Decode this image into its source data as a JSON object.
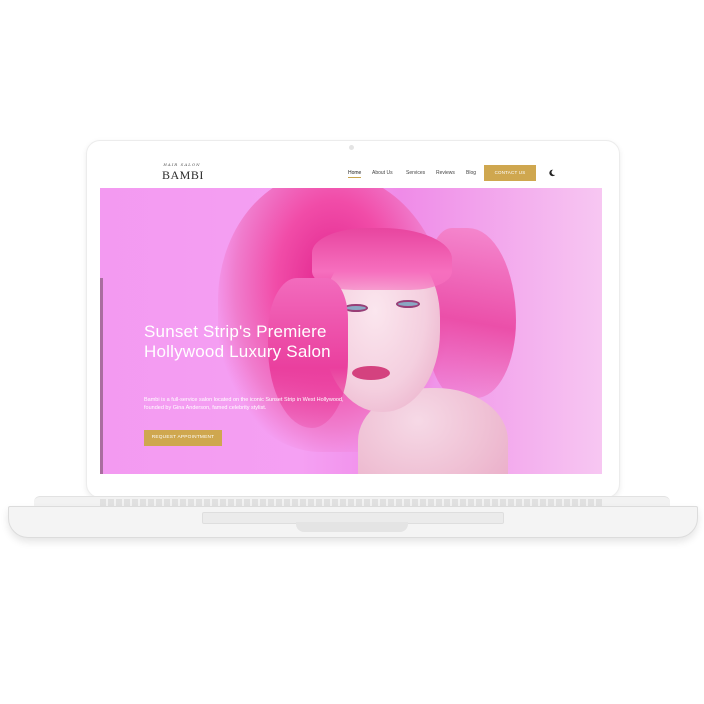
{
  "site": {
    "logo_tagline": "HAIR SALON",
    "logo_name": "BAMBI"
  },
  "nav": {
    "items": [
      {
        "label": "Home",
        "active": true
      },
      {
        "label": "About Us",
        "active": false
      },
      {
        "label": "Services",
        "active": false
      },
      {
        "label": "Reviews",
        "active": false
      },
      {
        "label": "Blog",
        "active": false
      }
    ],
    "cta_label": "CONTACT US",
    "theme_toggle_icon": "moon-icon"
  },
  "hero": {
    "title": "Sunset Strip's Premiere Hollywood Luxury Salon",
    "text": "Bambi is a full-service salon located on the iconic Sunset Strip in West Hollywood, founded by Gina Anderson, famed celebrity stylist.",
    "button_label": "REQUEST APPOINTMENT"
  },
  "colors": {
    "accent_gold": "#cfa74f",
    "hero_pink": "#f39af1"
  }
}
